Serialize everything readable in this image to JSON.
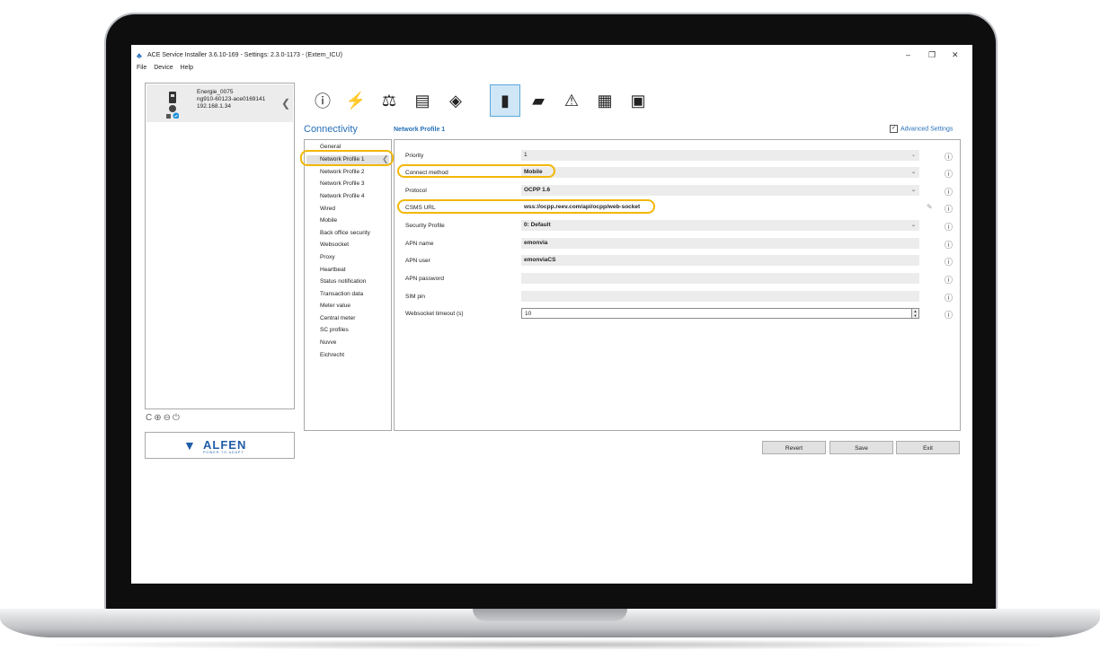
{
  "window": {
    "title": "ACE Service Installer 3.6.10-169 - Settings: 2.3.0-1173 - (Extern_ICU)",
    "minimize": "–",
    "restore": "❐",
    "close": "✕"
  },
  "menu": [
    "File",
    "Device",
    "Help"
  ],
  "device": {
    "name": "Energie_0075",
    "id": "ng910-60123-ace0169141",
    "ip": "192.168.1.34"
  },
  "panel_tools": "C⊕⊖⏻",
  "logo": {
    "word": "ALFEN",
    "tagline": "POWER TO ADAPT"
  },
  "toolbar": [
    {
      "icon": "info-icon",
      "glyph": "ⓘ"
    },
    {
      "icon": "power-grid-icon",
      "glyph": "⚡"
    },
    {
      "icon": "balance-icon",
      "glyph": "⚖"
    },
    {
      "icon": "card-reader-icon",
      "glyph": "▤"
    },
    {
      "icon": "payment-icon",
      "glyph": "◈"
    },
    {
      "icon": "connectivity-icon",
      "glyph": "▮"
    },
    {
      "icon": "image-icon",
      "glyph": "▰"
    },
    {
      "icon": "warning-icon",
      "glyph": "⚠"
    },
    {
      "icon": "document-icon",
      "glyph": "▦"
    },
    {
      "icon": "monitor-icon",
      "glyph": "▣"
    }
  ],
  "section_title": "Connectivity",
  "nav": [
    "General",
    "Network Profile 1",
    "Network Profile 2",
    "Network Profile 3",
    "Network Profile 4",
    "Wired",
    "Mobile",
    "Back office security",
    "Websocket",
    "Proxy",
    "Heartbeat",
    "Status notification",
    "Transaction data",
    "Meter value",
    "Central meter",
    "SC profiles",
    "Nuvve",
    "Eichrecht"
  ],
  "profile_title": "Network Profile 1",
  "advanced_settings": {
    "label": "Advanced Settings",
    "checked": "✓"
  },
  "fields": [
    {
      "label": "Priority",
      "value": "1"
    },
    {
      "label": "Connect method",
      "value": "Mobile"
    },
    {
      "label": "Protocol",
      "value": "OCPP 1.6"
    },
    {
      "label": "CSMS URL",
      "value": "wss://ocpp.reev.com/api/ocpp/web-socket"
    },
    {
      "label": "Security Profile",
      "value": "0: Default"
    },
    {
      "label": "APN name",
      "value": "emonvia"
    },
    {
      "label": "APN user",
      "value": "emonviaCS"
    },
    {
      "label": "APN password",
      "value": ""
    },
    {
      "label": "SIM pin",
      "value": ""
    },
    {
      "label": "Websocket timeout (s)",
      "value": "10"
    }
  ],
  "buttons": {
    "revert": "Revert",
    "save": "Save",
    "exit": "Exit"
  },
  "colors": {
    "accent": "#2870b8",
    "highlight": "#f2b705",
    "selected_tool": "#cfe6f7"
  }
}
